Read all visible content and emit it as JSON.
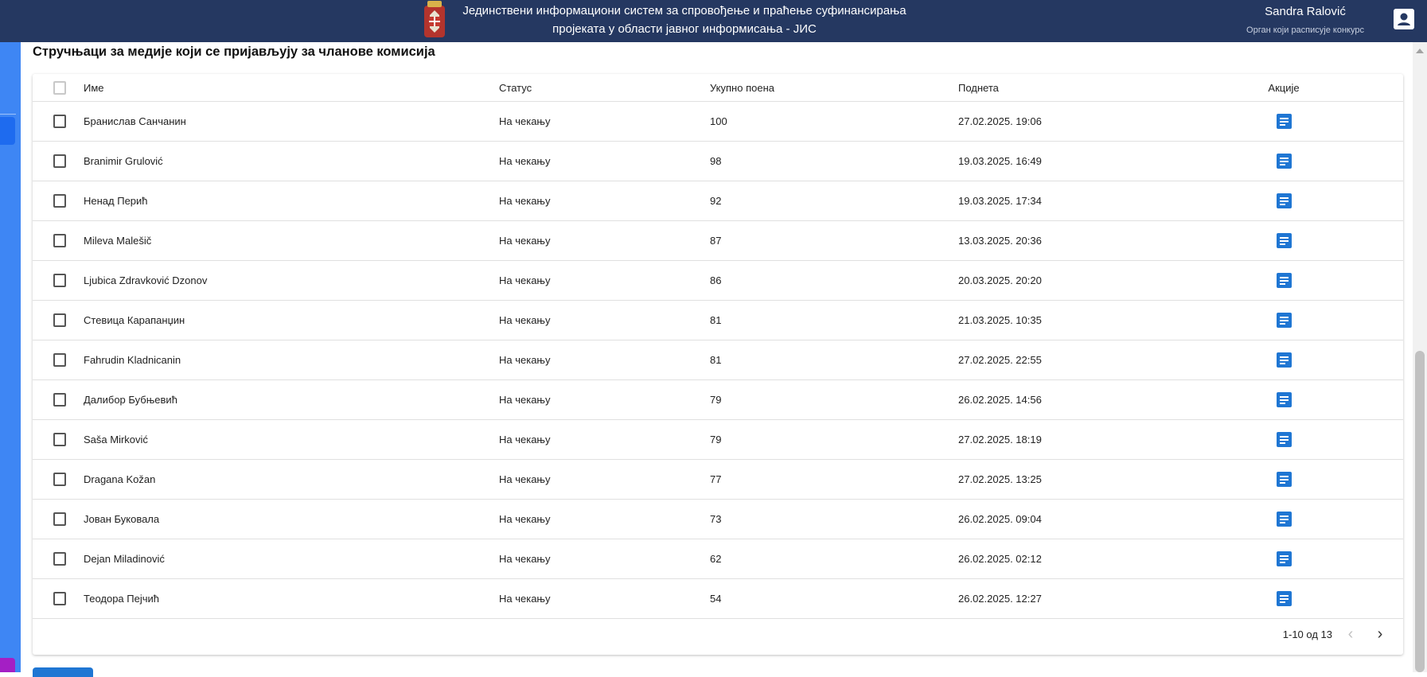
{
  "header": {
    "title_line1": "Јединствени информациони систем за спровођење и праћење суфинансирања",
    "title_line2": "пројеката у области јавног информисања - ЈИС",
    "user_name": "Sandra Ralović",
    "user_role": "Орган који расписује конкурс"
  },
  "section": {
    "title": "Стручњаци за медије који се пријављују за чланове комисија"
  },
  "table": {
    "columns": {
      "name": "Име",
      "status": "Статус",
      "points": "Укупно поена",
      "submitted": "Поднета",
      "actions": "Акције"
    },
    "rows": [
      {
        "name": "Бранислав Санчанин",
        "status": "На чекању",
        "points": "100",
        "submitted": "27.02.2025. 19:06"
      },
      {
        "name": "Branimir Grulović",
        "status": "На чекању",
        "points": "98",
        "submitted": "19.03.2025. 16:49"
      },
      {
        "name": "Ненад Перић",
        "status": "На чекању",
        "points": "92",
        "submitted": "19.03.2025. 17:34"
      },
      {
        "name": "Mileva Malešič",
        "status": "На чекању",
        "points": "87",
        "submitted": "13.03.2025. 20:36"
      },
      {
        "name": "Ljubica Zdravković Dzonov",
        "status": "На чекању",
        "points": "86",
        "submitted": "20.03.2025. 20:20"
      },
      {
        "name": "Стевица Карапанџин",
        "status": "На чекању",
        "points": "81",
        "submitted": "21.03.2025. 10:35"
      },
      {
        "name": "Fahrudin Kladnicanin",
        "status": "На чекању",
        "points": "81",
        "submitted": "27.02.2025. 22:55"
      },
      {
        "name": "Далибор Бубњевић",
        "status": "На чекању",
        "points": "79",
        "submitted": "26.02.2025. 14:56"
      },
      {
        "name": "Saša Mirković",
        "status": "На чекању",
        "points": "79",
        "submitted": "27.02.2025. 18:19"
      },
      {
        "name": "Dragana Kožan",
        "status": "На чекању",
        "points": "77",
        "submitted": "27.02.2025. 13:25"
      },
      {
        "name": "Јован Буковала",
        "status": "На чекању",
        "points": "73",
        "submitted": "26.02.2025. 09:04"
      },
      {
        "name": "Dejan Miladinović",
        "status": "На чекању",
        "points": "62",
        "submitted": "26.02.2025. 02:12"
      },
      {
        "name": "Теодора Пејчић",
        "status": "На чекању",
        "points": "54",
        "submitted": "26.02.2025. 12:27"
      }
    ]
  },
  "pagination": {
    "range": "1-10 од 13",
    "prev_icon": "chevron-left-icon",
    "next_icon": "chevron-right-icon"
  },
  "colors": {
    "header_bg": "#253861",
    "sidebar_blue": "#3e86f4",
    "action_icon": "#1f76d3"
  }
}
